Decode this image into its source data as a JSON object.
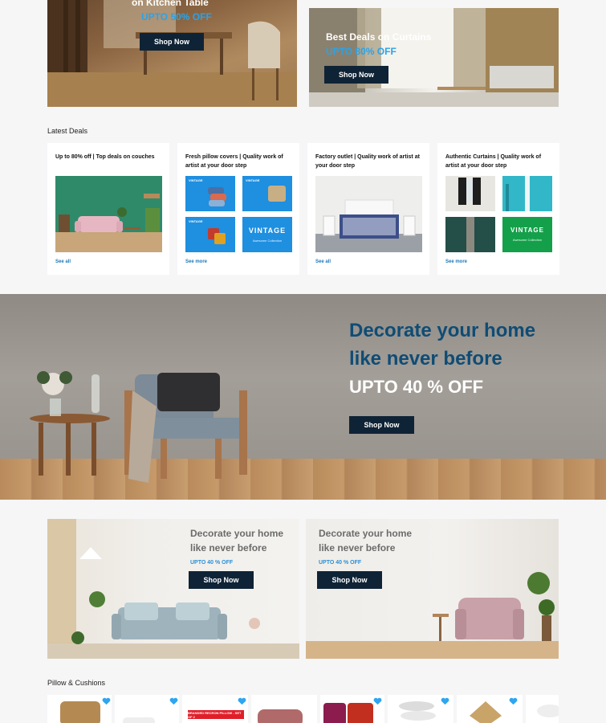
{
  "promos": [
    {
      "title": "on Kitchen Table",
      "offer": "UPTO 50% OFF",
      "button": "Shop Now"
    },
    {
      "title": "Best Deals on Curtains",
      "offer": "UPTO 80% OFF",
      "button": "Shop Now"
    }
  ],
  "latest_deals": {
    "heading": "Latest Deals",
    "cards": [
      {
        "title": "Up to 80% off | Top deals on couches",
        "link": "See all"
      },
      {
        "title": "Fresh pillow covers | Quality work of artist at your door step",
        "link": "See more",
        "tiles": [
          "VINTAGE",
          "VINTAGE",
          "VINTAGE",
          "VINTAGE"
        ],
        "tile_sub": "Awesome Collection"
      },
      {
        "title": "Factory outlet | Quality work of artist at your door step",
        "link": "See all"
      },
      {
        "title": "Authentic Curtains | Quality work of artist at your door step",
        "link": "See more",
        "tile_label": "VINTAGE",
        "tile_sub": "Awesome Collection"
      }
    ]
  },
  "hero": {
    "line1": "Decorate your home",
    "line2": "like never before",
    "offer": "UPTO 40 % OFF",
    "button": "Shop Now"
  },
  "mid_banners": [
    {
      "line1": "Decorate your home",
      "line2": "like never before",
      "offer": "UPTO 40 % OFF",
      "button": "Shop Now"
    },
    {
      "line1": "Decorate your home",
      "line2": "like never before",
      "offer": "UPTO 40 % OFF",
      "button": "Shop Now"
    }
  ],
  "pillows": {
    "heading": "Pillow & Cushions",
    "badge": "BRANDED RECRON PILLOW - SET OF 2"
  },
  "colors": {
    "accent": "#2aa3e8",
    "navy": "#0f2336",
    "heading_blue": "#0f4c75",
    "heart": "#2ea6f0"
  },
  "icons": [
    "heart-icon"
  ]
}
